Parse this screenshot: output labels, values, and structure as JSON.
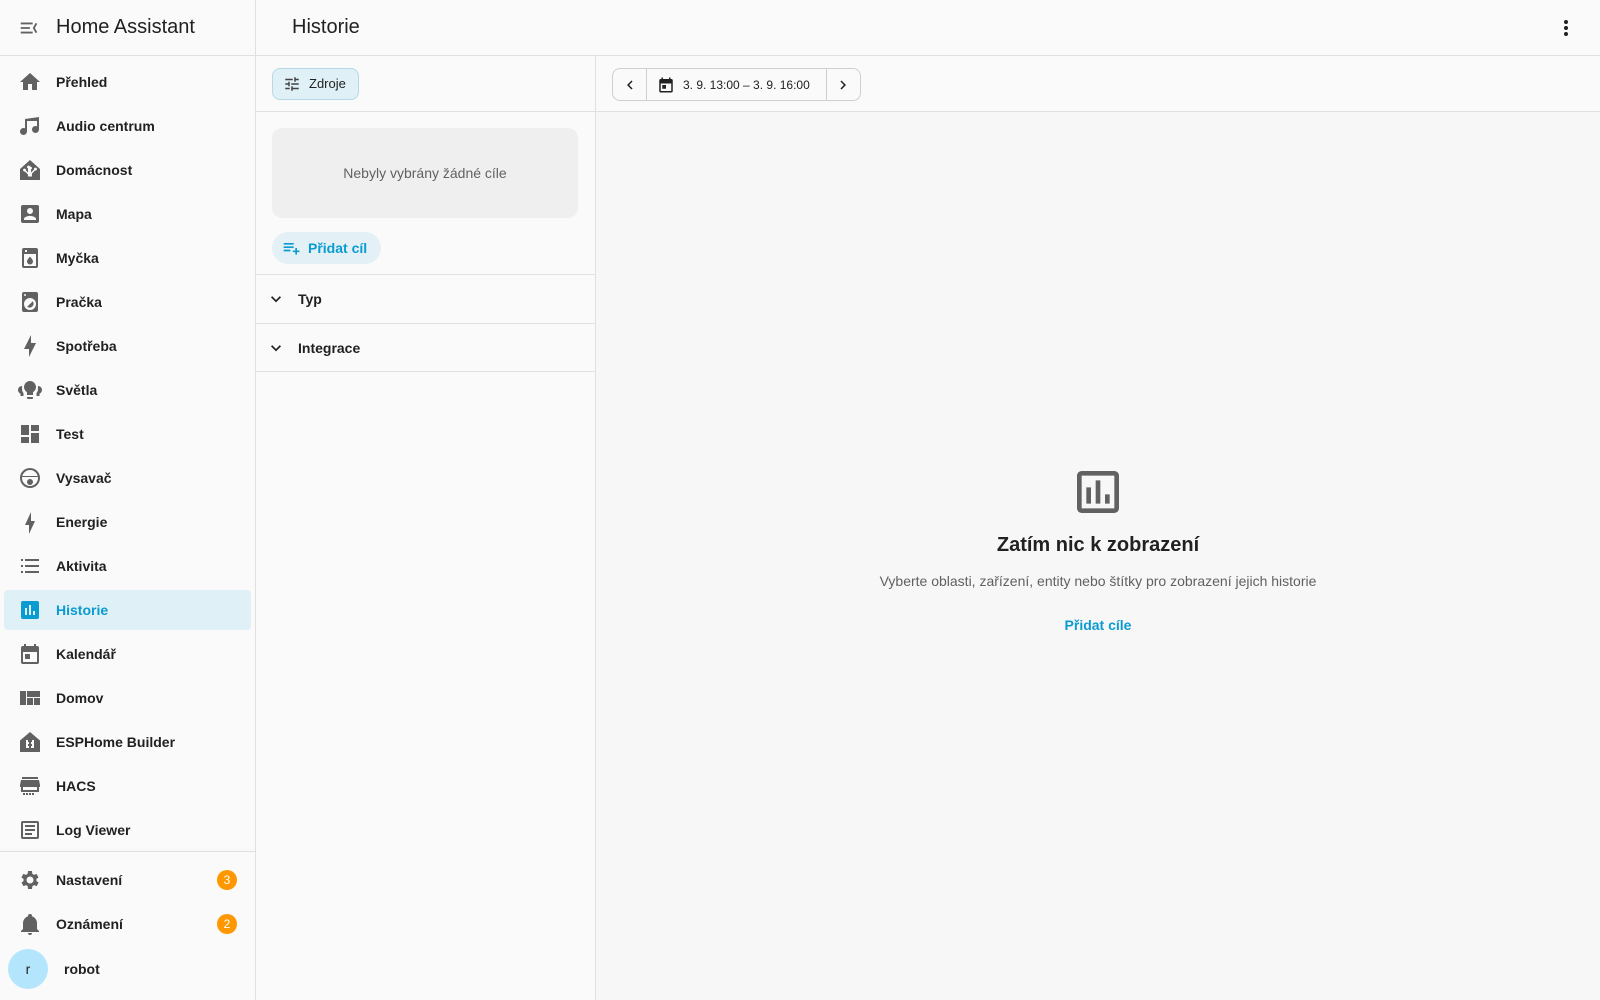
{
  "app": {
    "title": "Home Assistant"
  },
  "page": {
    "title": "Historie"
  },
  "sidebar": {
    "items": [
      {
        "label": "Přehled",
        "icon": "home-icon"
      },
      {
        "label": "Audio centrum",
        "icon": "music-note-icon"
      },
      {
        "label": "Domácnost",
        "icon": "home-assistant-icon"
      },
      {
        "label": "Mapa",
        "icon": "account-box-icon"
      },
      {
        "label": "Myčka",
        "icon": "dishwasher-icon"
      },
      {
        "label": "Pračka",
        "icon": "washing-machine-icon"
      },
      {
        "label": "Spotřeba",
        "icon": "lightning-bolt-icon"
      },
      {
        "label": "Světla",
        "icon": "lightbulb-group-icon"
      },
      {
        "label": "Test",
        "icon": "view-dashboard-icon"
      },
      {
        "label": "Vysavač",
        "icon": "robot-vacuum-icon"
      },
      {
        "label": "Energie",
        "icon": "lightning-icon"
      },
      {
        "label": "Aktivita",
        "icon": "format-list-icon"
      },
      {
        "label": "Historie",
        "icon": "chart-box-icon",
        "active": true
      },
      {
        "label": "Kalendář",
        "icon": "calendar-icon"
      },
      {
        "label": "Domov",
        "icon": "view-quilt-icon"
      },
      {
        "label": "ESPHome Builder",
        "icon": "esphome-icon"
      },
      {
        "label": "HACS",
        "icon": "hacs-store-icon"
      },
      {
        "label": "Log Viewer",
        "icon": "text-box-icon"
      }
    ],
    "settings": {
      "label": "Nastavení",
      "badge": "3"
    },
    "notifications": {
      "label": "Oznámení",
      "badge": "2"
    },
    "user": {
      "initial": "r",
      "name": "robot"
    }
  },
  "filters": {
    "sources_label": "Zdroje",
    "no_targets": "Nebyly vybrány žádné cíle",
    "add_target": "Přidat cíl",
    "sections": [
      "Typ",
      "Integrace"
    ]
  },
  "datebar": {
    "range": "3. 9. 13:00 – 3. 9. 16:00"
  },
  "empty_state": {
    "title": "Zatím nic k zobrazení",
    "description": "Vyberte oblasti, zařízení, entity nebo štítky pro zobrazení jejich historie",
    "link": "Přidat cíle"
  },
  "colors": {
    "accent": "#0a9bd1",
    "badge": "#ff9800",
    "active_bg": "#dff0f7"
  }
}
